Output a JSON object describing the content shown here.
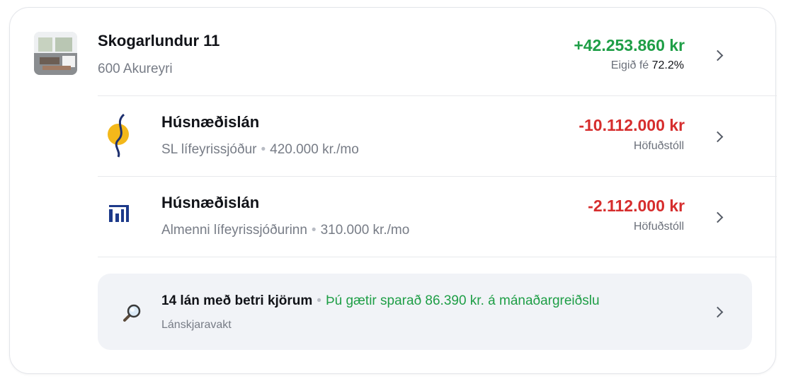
{
  "colors": {
    "positive": "#1e9e46",
    "negative": "#d62d2d",
    "muted": "#777c86",
    "banner_bg": "#f1f3f7"
  },
  "property": {
    "name": "Skogarlundur 11",
    "address": "600 Akureyri",
    "equity_amount": "+42.253.860 kr",
    "equity_label": "Eigið fé",
    "equity_percent": "72.2%",
    "thumbnail_icon": "house-photo"
  },
  "loans": [
    {
      "title": "Húsnæðislán",
      "lender": "SL lífeyrissjóður",
      "separator": "•",
      "payment": "420.000 kr./mo",
      "amount": "-10.112.000 kr",
      "amount_label": "Höfuðstóll",
      "logo_icon": "sl-lifeyrissjodur-logo"
    },
    {
      "title": "Húsnæðislán",
      "lender": "Almenni lífeyrissjóðurinn",
      "separator": "•",
      "payment": "310.000 kr./mo",
      "amount": "-2.112.000 kr",
      "amount_label": "Höfuðstóll",
      "logo_icon": "almenni-logo"
    }
  ],
  "banner": {
    "title": "14 lán með betri kjörum",
    "separator": "•",
    "savings": "Þú gætir sparað 86.390 kr. á mánaðargreiðslu",
    "subtitle": "Lánskjaravakt",
    "icon": "magnifier-icon"
  }
}
